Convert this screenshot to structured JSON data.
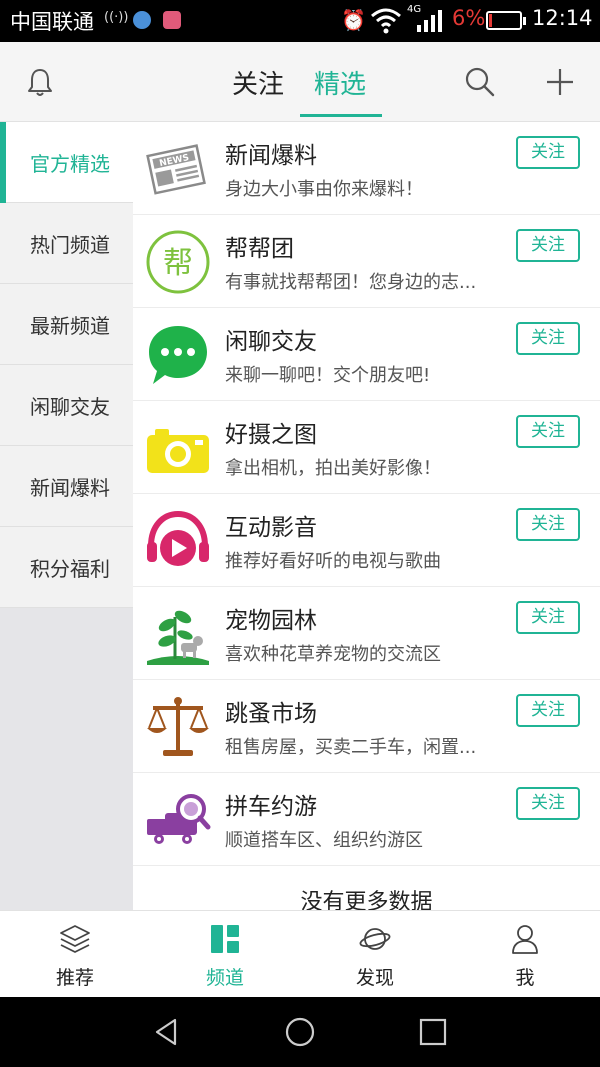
{
  "status_bar": {
    "carrier": "中国联通",
    "network": "4G",
    "battery": "6%",
    "time": "12:14"
  },
  "header": {
    "tabs": [
      {
        "label": "关注",
        "active": false
      },
      {
        "label": "精选",
        "active": true
      }
    ],
    "icons": [
      "bell-icon",
      "search-icon",
      "plus-icon"
    ]
  },
  "sidebar": {
    "items": [
      {
        "label": "官方精选",
        "active": true
      },
      {
        "label": "热门频道",
        "active": false
      },
      {
        "label": "最新频道",
        "active": false
      },
      {
        "label": "闲聊交友",
        "active": false
      },
      {
        "label": "新闻爆料",
        "active": false
      },
      {
        "label": "积分福利",
        "active": false
      }
    ]
  },
  "channels": [
    {
      "title": "新闻爆料",
      "desc": "身边大小事由你来爆料！",
      "button": "关注",
      "icon": "newspaper-icon"
    },
    {
      "title": "帮帮团",
      "desc": "有事就找帮帮团！您身边的志...",
      "button": "关注",
      "icon": "help-group-icon"
    },
    {
      "title": "闲聊交友",
      "desc": "来聊一聊吧！交个朋友吧!",
      "button": "关注",
      "icon": "chat-bubble-icon"
    },
    {
      "title": "好摄之图",
      "desc": "拿出相机，拍出美好影像！",
      "button": "关注",
      "icon": "camera-icon"
    },
    {
      "title": "互动影音",
      "desc": "推荐好看好听的电视与歌曲",
      "button": "关注",
      "icon": "headphones-play-icon"
    },
    {
      "title": "宠物园林",
      "desc": "喜欢种花草养宠物的交流区",
      "button": "关注",
      "icon": "plant-pet-icon"
    },
    {
      "title": "跳蚤市场",
      "desc": "租售房屋，买卖二手车，闲置...",
      "button": "关注",
      "icon": "scale-icon"
    },
    {
      "title": "拼车约游",
      "desc": "顺道搭车区、组织约游区",
      "button": "关注",
      "icon": "truck-search-icon"
    }
  ],
  "list_footer": "没有更多数据",
  "bottom_nav": {
    "items": [
      {
        "label": "推荐",
        "icon": "layers-icon",
        "active": false
      },
      {
        "label": "频道",
        "icon": "grid-icon",
        "active": true
      },
      {
        "label": "发现",
        "icon": "planet-icon",
        "active": false
      },
      {
        "label": "我",
        "icon": "person-icon",
        "active": false
      }
    ]
  },
  "colors": {
    "accent": "#20b495"
  }
}
